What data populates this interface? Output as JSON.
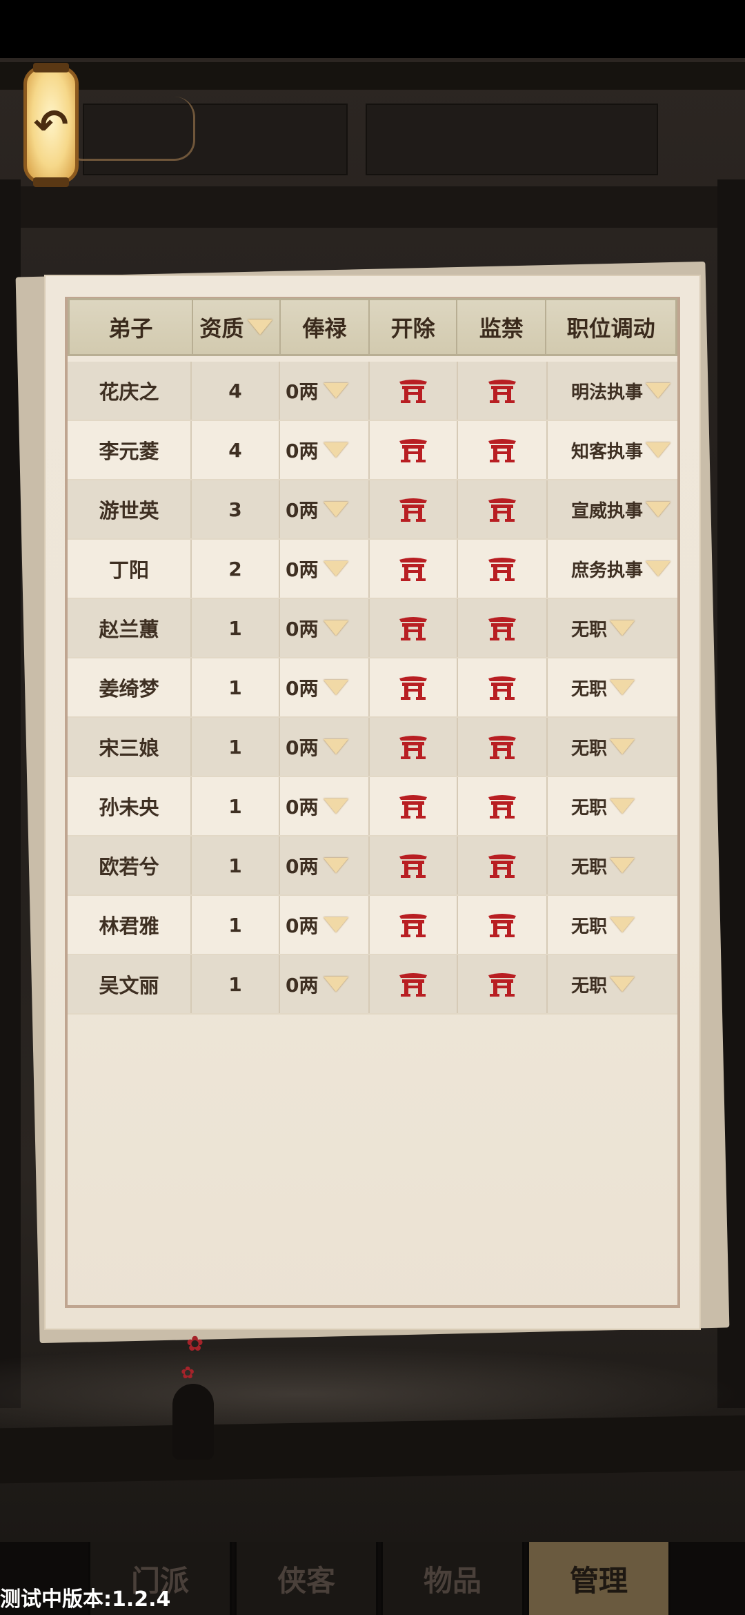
{
  "table": {
    "headers": {
      "disciple": "弟子",
      "aptitude": "资质",
      "salary": "俸禄",
      "dismiss": "开除",
      "imprison": "监禁",
      "position": "职位调动"
    },
    "rows": [
      {
        "name": "花庆之",
        "aptitude": "4",
        "salary": "0两",
        "position": "明法执事"
      },
      {
        "name": "李元菱",
        "aptitude": "4",
        "salary": "0两",
        "position": "知客执事"
      },
      {
        "name": "游世英",
        "aptitude": "3",
        "salary": "0两",
        "position": "宣威执事"
      },
      {
        "name": "丁阳",
        "aptitude": "2",
        "salary": "0两",
        "position": "庶务执事"
      },
      {
        "name": "赵兰蕙",
        "aptitude": "1",
        "salary": "0两",
        "position": "无职"
      },
      {
        "name": "姜绮梦",
        "aptitude": "1",
        "salary": "0两",
        "position": "无职"
      },
      {
        "name": "宋三娘",
        "aptitude": "1",
        "salary": "0两",
        "position": "无职"
      },
      {
        "name": "孙未央",
        "aptitude": "1",
        "salary": "0两",
        "position": "无职"
      },
      {
        "name": "欧若兮",
        "aptitude": "1",
        "salary": "0两",
        "position": "无职"
      },
      {
        "name": "林君雅",
        "aptitude": "1",
        "salary": "0两",
        "position": "无职"
      },
      {
        "name": "吴文丽",
        "aptitude": "1",
        "salary": "0两",
        "position": "无职"
      }
    ]
  },
  "tabs": [
    "门派",
    "侠客",
    "物品",
    "管理"
  ],
  "active_tab": "管理",
  "version_text": "测试中版本:1.2.4",
  "icons": {
    "back": "back-arrow-icon",
    "dismiss": "gate-icon",
    "imprison": "gate-icon",
    "dropdown": "dropdown-triangle-icon"
  },
  "colors": {
    "gate_red": "#b81e22",
    "paper": "#eee6d8",
    "header": "#d8d0b8",
    "active_tab": "#6a5a3f"
  }
}
